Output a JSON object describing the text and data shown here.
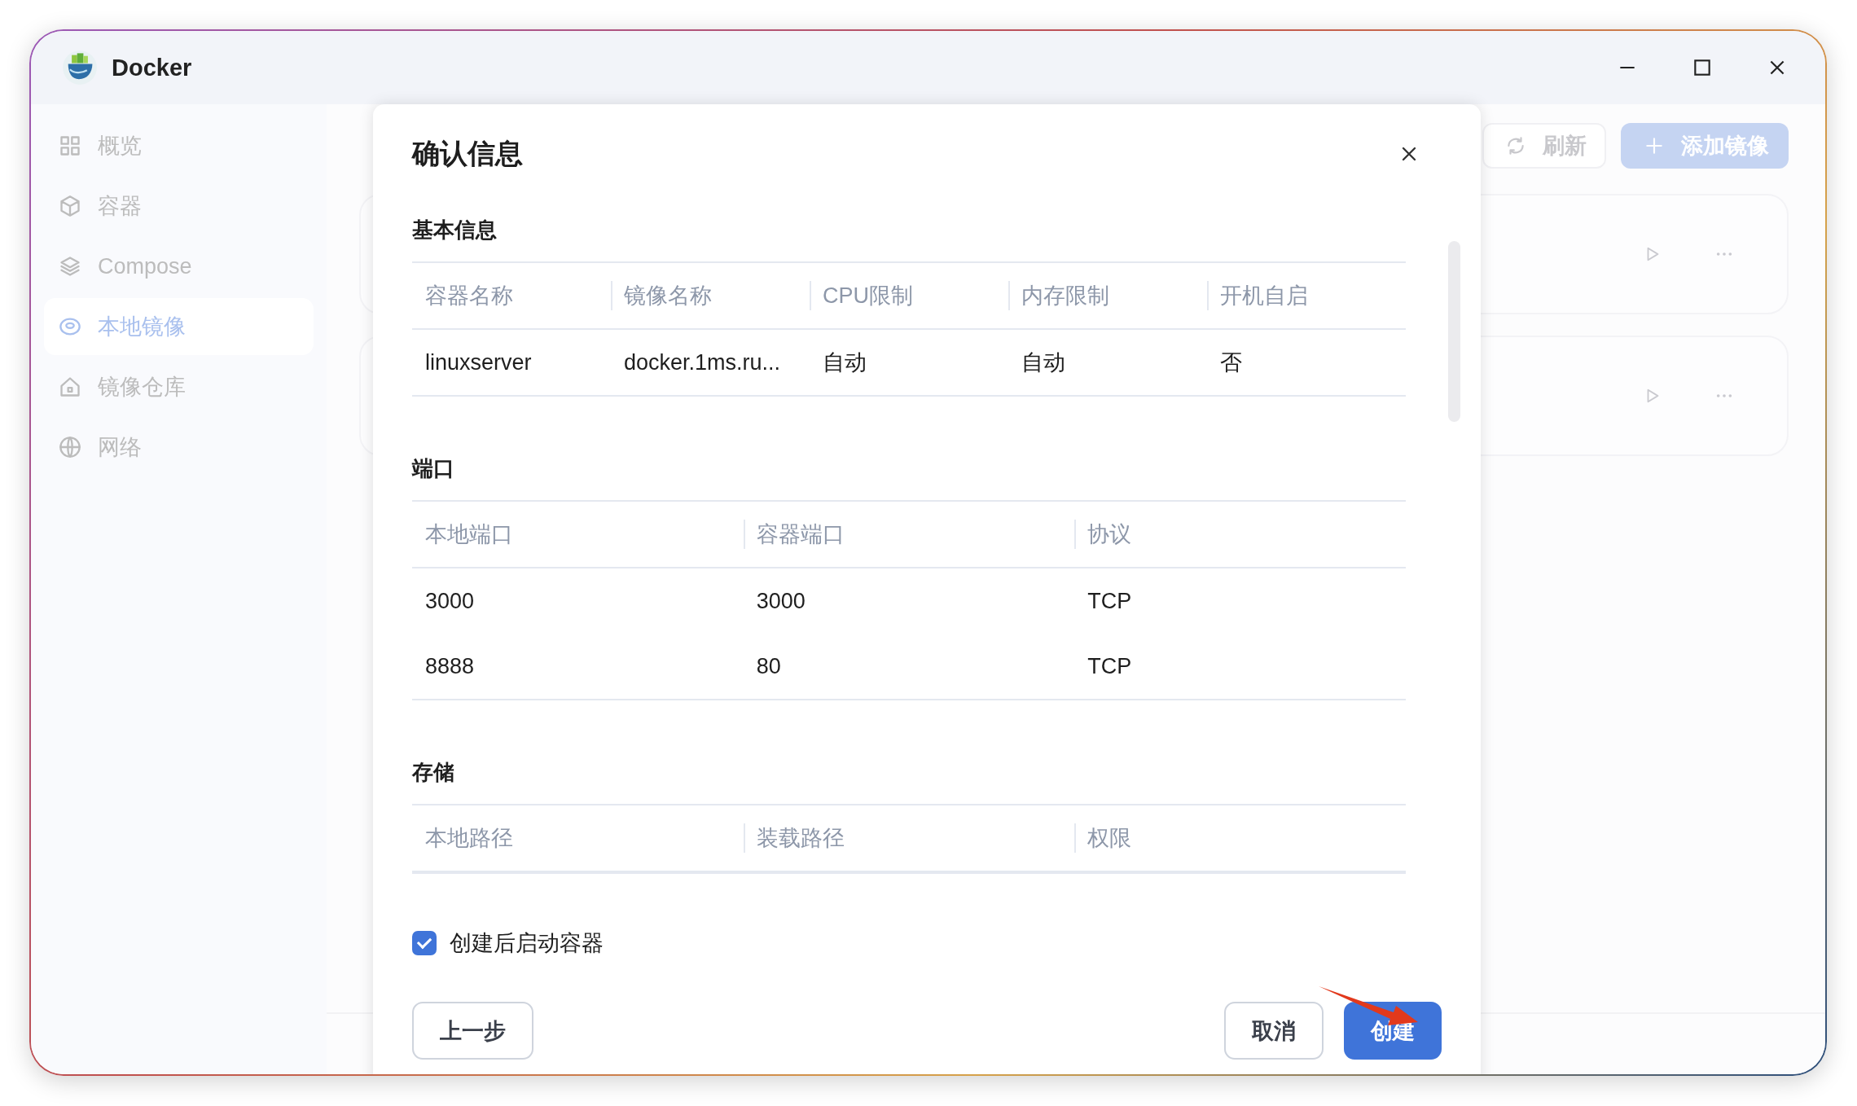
{
  "window": {
    "title": "Docker"
  },
  "sidebar": {
    "items": [
      {
        "label": "概览",
        "selected": false
      },
      {
        "label": "容器",
        "selected": false
      },
      {
        "label": "Compose",
        "selected": false
      },
      {
        "label": "本地镜像",
        "selected": true
      },
      {
        "label": "镜像仓库",
        "selected": false
      },
      {
        "label": "网络",
        "selected": false
      }
    ]
  },
  "main": {
    "toolbar": [
      {
        "label": "刷新",
        "kind": "refresh"
      },
      {
        "label": "添加镜像",
        "kind": "add"
      }
    ]
  },
  "dialog": {
    "title": "确认信息",
    "sections": [
      {
        "title": "基本信息",
        "columns": [
          "容器名称",
          "镜像名称",
          "CPU限制",
          "内存限制",
          "开机自启"
        ],
        "rows": [
          [
            "linuxserver",
            "docker.1ms.ru...",
            "自动",
            "自动",
            "否"
          ]
        ]
      },
      {
        "title": "端口",
        "columns": [
          "本地端口",
          "容器端口",
          "协议"
        ],
        "rows": [
          [
            "3000",
            "3000",
            "TCP"
          ],
          [
            "8888",
            "80",
            "TCP"
          ]
        ]
      },
      {
        "title": "存储",
        "columns": [
          "本地路径",
          "装载路径",
          "权限"
        ]
      }
    ],
    "start_after_create": {
      "label": "创建后启动容器",
      "checked": true
    },
    "buttons": [
      {
        "label": "上一步",
        "kind": "back"
      },
      {
        "label": "取消",
        "kind": "default"
      },
      {
        "label": "创建",
        "kind": "primary"
      }
    ]
  }
}
